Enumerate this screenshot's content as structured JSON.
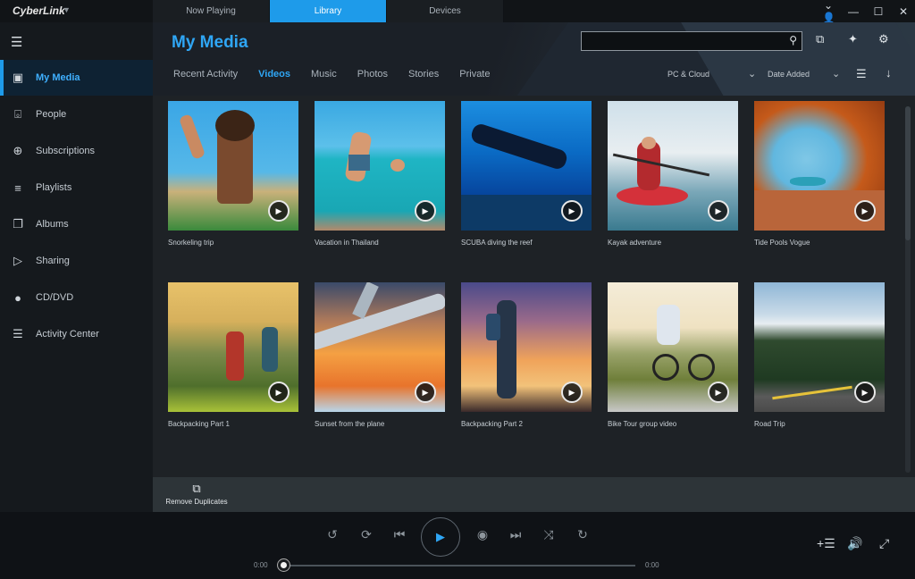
{
  "app": {
    "logo": "CyberLink",
    "top_tabs": [
      "Now Playing",
      "Library",
      "Devices"
    ],
    "active_top_tab": 1,
    "window_controls": [
      "user-icon",
      "minimize-icon",
      "maximize-icon",
      "close-icon"
    ]
  },
  "sidebar": {
    "items": [
      {
        "label": "My Media",
        "icon": "media-icon",
        "active": true
      },
      {
        "label": "People",
        "icon": "face-icon"
      },
      {
        "label": "Subscriptions",
        "icon": "subscriptions-icon"
      },
      {
        "label": "Playlists",
        "icon": "playlist-icon"
      },
      {
        "label": "Albums",
        "icon": "album-icon"
      },
      {
        "label": "Sharing",
        "icon": "share-icon"
      },
      {
        "label": "CD/DVD",
        "icon": "disc-icon"
      },
      {
        "label": "Activity Center",
        "icon": "activity-icon"
      }
    ]
  },
  "header": {
    "title": "My Media",
    "search": {
      "value": "",
      "placeholder": ""
    },
    "subtabs": [
      "Recent Activity",
      "Videos",
      "Music",
      "Photos",
      "Stories",
      "Private"
    ],
    "active_subtab": 1,
    "location_filter": "PC & Cloud",
    "sort": "Date Added"
  },
  "videos": [
    {
      "title": "Snorkeling trip"
    },
    {
      "title": "Vacation in Thailand"
    },
    {
      "title": "SCUBA diving the reef"
    },
    {
      "title": "Kayak adventure"
    },
    {
      "title": "Tide Pools Vogue"
    },
    {
      "title": "Backpacking Part 1"
    },
    {
      "title": "Sunset from the plane"
    },
    {
      "title": "Backpacking Part 2"
    },
    {
      "title": "Bike Tour group video"
    },
    {
      "title": "Road Trip"
    }
  ],
  "actions": {
    "remove_duplicates": "Remove Duplicates"
  },
  "player": {
    "time_elapsed": "0:00",
    "time_total": "0:00",
    "progress": 0
  },
  "colors": {
    "accent": "#1e9bea",
    "background": "#0f1216"
  }
}
